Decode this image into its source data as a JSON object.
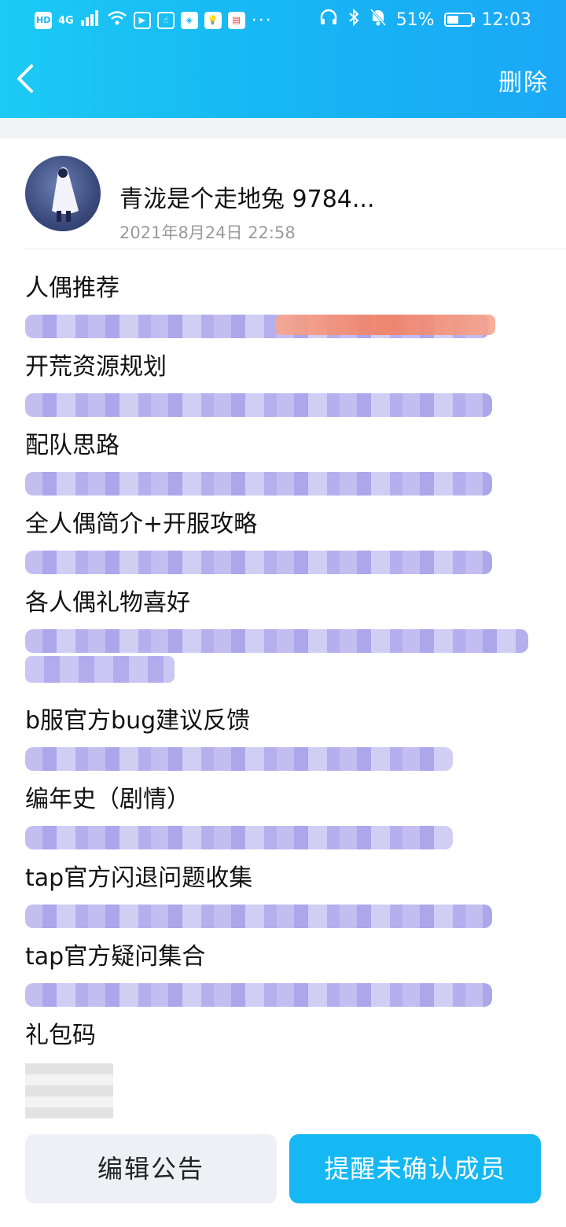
{
  "status_bar": {
    "network": "4G",
    "more": "···",
    "battery": "51%",
    "battery_level": 0.51,
    "time": "12:03"
  },
  "nav": {
    "delete_label": "删除"
  },
  "author": {
    "name": "青泷是个走地兔 9784...",
    "time": "2021年8月24日 22:58"
  },
  "entries": [
    {
      "title": "人偶推荐"
    },
    {
      "title": "开荒资源规划"
    },
    {
      "title": "配队思路"
    },
    {
      "title": "全人偶简介+开服攻略"
    },
    {
      "title": "各人偶礼物喜好"
    },
    {
      "title": "b服官方bug建议反馈"
    },
    {
      "title": "编年史（剧情）"
    },
    {
      "title": "tap官方闪退问题收集"
    },
    {
      "title": "tap官方疑问集合"
    },
    {
      "title": "礼包码"
    }
  ],
  "buttons": {
    "edit": "编辑公告",
    "remind": "提醒未确认成员"
  },
  "colors": {
    "header": "#17b6f4",
    "primary_button": "#15b8f3",
    "secondary_button": "#eef0f5"
  }
}
